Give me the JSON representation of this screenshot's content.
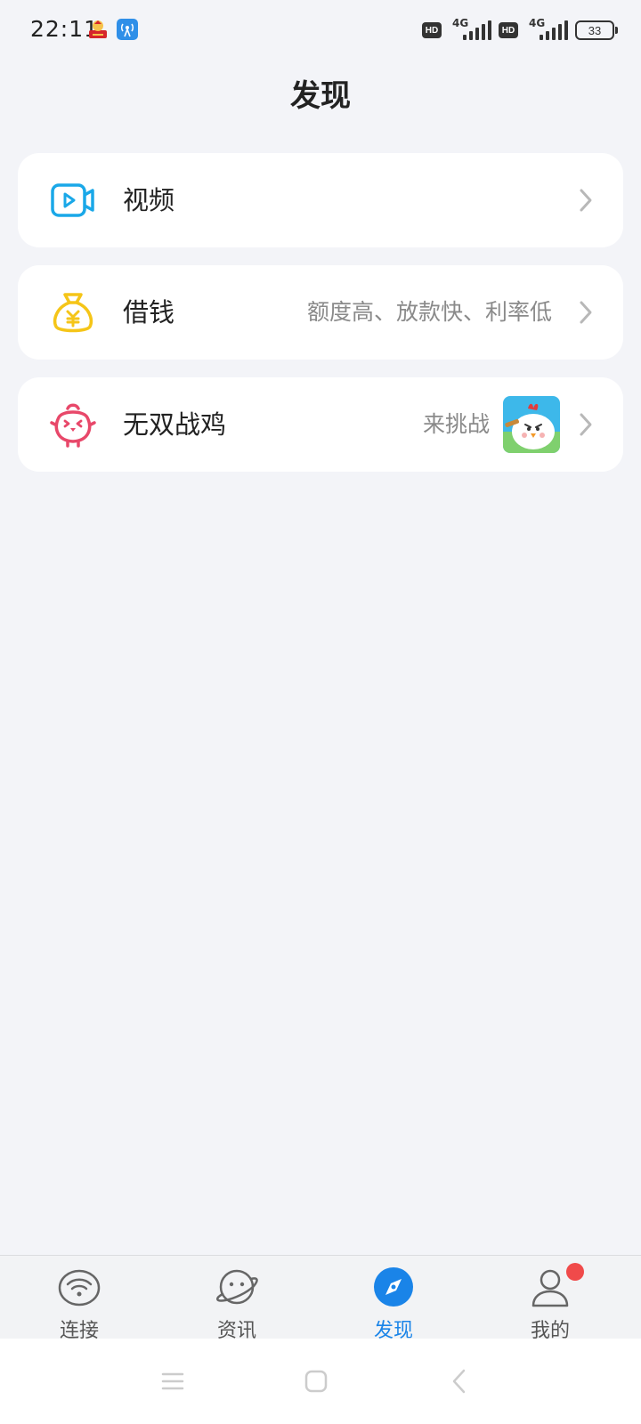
{
  "status_bar": {
    "time": "22:11",
    "network_1": "4G",
    "network_2": "4G",
    "hd_label": "HD",
    "battery": "33",
    "icons": [
      "notification-app-icon",
      "hotspot-icon",
      "signal-icon",
      "battery-icon"
    ]
  },
  "header": {
    "title": "发现"
  },
  "cards": [
    {
      "label": "视频",
      "subtitle": "",
      "icon": "video-icon",
      "accent": "#1aa8e8"
    },
    {
      "label": "借钱",
      "subtitle": "额度高、放款快、利率低",
      "icon": "money-bag-icon",
      "accent": "#f5c518"
    },
    {
      "label": "无双战鸡",
      "subtitle": "来挑战",
      "icon": "chick-icon",
      "accent": "#e8486a"
    }
  ],
  "bottom_nav": {
    "tabs": [
      {
        "label": "连接",
        "icon": "wifi-icon",
        "active": false
      },
      {
        "label": "资讯",
        "icon": "planet-icon",
        "active": false
      },
      {
        "label": "发现",
        "icon": "compass-icon",
        "active": true
      },
      {
        "label": "我的",
        "icon": "person-icon",
        "active": false
      }
    ],
    "active_color": "#1a84e8",
    "badge_color": "#f04a4a"
  },
  "system_nav": {
    "buttons": [
      "menu-icon",
      "home-icon",
      "back-icon"
    ]
  }
}
